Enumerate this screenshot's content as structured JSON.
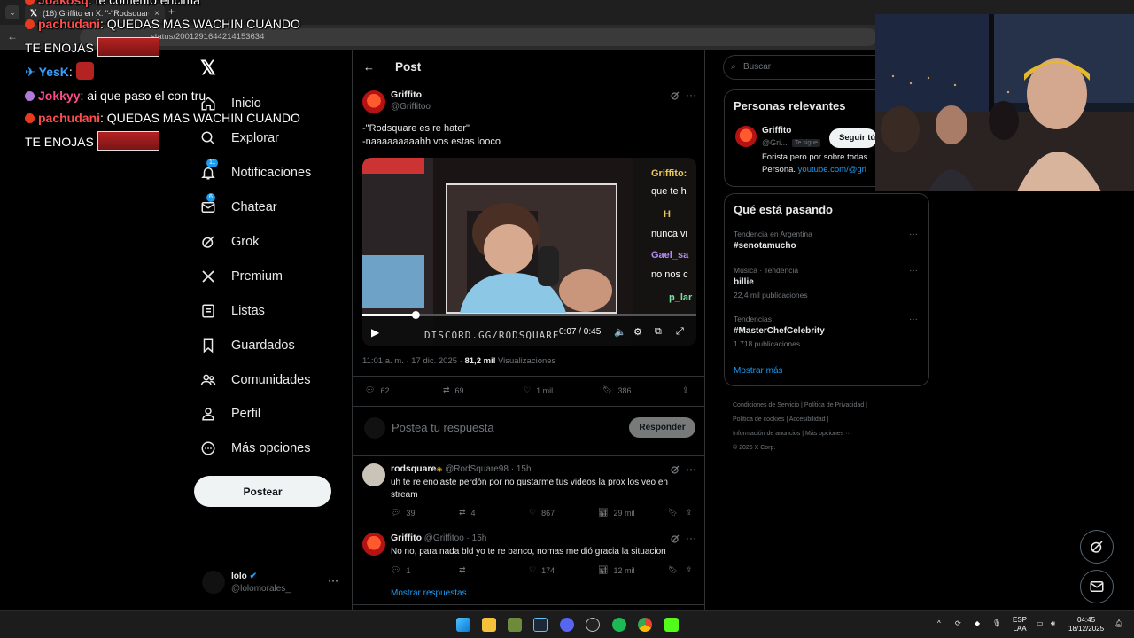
{
  "browser": {
    "tab_title": "(16) Griffito en X: \"-\"Rodsquare",
    "url_fragment": "status/2001291644214153634",
    "new_tab": "+",
    "close": "×"
  },
  "chat_overlay": [
    {
      "user": "Joakosq",
      "message": ": te comento encima"
    },
    {
      "user": "pachudani",
      "message": ": QUEDAS MAS WACHIN CUANDO"
    },
    {
      "continuation": "TE ENOJAS"
    },
    {
      "user": "YesK",
      "message": ":"
    },
    {
      "user": "Jokkyy",
      "message": ": ai que paso el con tru"
    },
    {
      "user": "pachudani",
      "message": ": QUEDAS MAS WACHIN CUANDO"
    },
    {
      "continuation": "TE ENOJAS"
    }
  ],
  "sidebar": {
    "items": [
      {
        "label": "Inicio",
        "icon": "home-icon"
      },
      {
        "label": "Explorar",
        "icon": "search-icon"
      },
      {
        "label": "Notificaciones",
        "icon": "bell-icon",
        "badge": "11"
      },
      {
        "label": "Chatear",
        "icon": "mail-icon",
        "badge": "6"
      },
      {
        "label": "Grok",
        "icon": "grok-icon"
      },
      {
        "label": "Premium",
        "icon": "x-icon"
      },
      {
        "label": "Listas",
        "icon": "list-icon"
      },
      {
        "label": "Guardados",
        "icon": "bookmark-icon"
      },
      {
        "label": "Comunidades",
        "icon": "people-icon"
      },
      {
        "label": "Perfil",
        "icon": "person-icon"
      },
      {
        "label": "Más opciones",
        "icon": "more-circle-icon"
      }
    ],
    "post_button": "Postear",
    "account": {
      "name": "lolo",
      "handle": "@lolomorales_",
      "more": "···"
    }
  },
  "post": {
    "header_title": "Post",
    "author_name": "Griffito",
    "author_handle": "@Griffitoo",
    "text": "-\"Rodsquare es re hater\"\n-naaaaaaaaahh vos estas looco",
    "video": {
      "time": "0:07 / 0:45",
      "overlay_text": "DISCORD.GG/RODSQUARE",
      "side_chat": [
        "Griffito:",
        "que te h",
        "H",
        "nunca vi",
        "Gael_sa",
        "no nos c",
        "p_lar",
        "H",
        "nunca vi"
      ],
      "progress": 0.16
    },
    "meta_time": "11:01 a. m. · 17 dic. 2025 ·",
    "meta_views": "81,2 mil",
    "meta_views_label": "Visualizaciones",
    "actions": {
      "replies": "62",
      "reposts": "69",
      "likes": "1 mil",
      "bookmarks": "386"
    },
    "reply_placeholder": "Postea tu respuesta",
    "reply_button": "Responder"
  },
  "replies": [
    {
      "name": "rodsquare",
      "handle": "@RodSquare98 · 15h",
      "text": "uh te re enojaste perdón por no gustarme tus videos la prox los veo en stream",
      "replies": "39",
      "reposts": "4",
      "likes": "867",
      "views": "29 mil"
    },
    {
      "name": "Griffito",
      "handle": "@Griffitoo · 15h",
      "text": "No no, para nada bld yo te re banco, nomas me dió gracia la situacion",
      "replies": "1",
      "reposts": "",
      "likes": "174",
      "views": "12 mil"
    }
  ],
  "show_replies": "Mostrar respuestas",
  "right": {
    "search_placeholder": "Buscar",
    "relevant_title": "Personas relevantes",
    "relevant": {
      "name": "Griffito",
      "handle": "@Gri...",
      "follows_you": "Te sigue",
      "follow_button": "Seguir tú",
      "bio": "Forista pero por sobre todas",
      "bio2": "Persona.",
      "link": "youtube.com/@gri"
    },
    "trends_title": "Qué está pasando",
    "trends": [
      {
        "meta": "Tendencia en Argentina",
        "name": "#senotamucho",
        "count": ""
      },
      {
        "meta": "Música · Tendencia",
        "name": "billie",
        "count": "22,4 mil publicaciones"
      },
      {
        "meta": "Tendencias",
        "name": "#MasterChefCelebrity",
        "count": "1.718 publicaciones"
      }
    ],
    "show_more": "Mostrar más",
    "footer": [
      "Condiciones de Servicio",
      "Política de Privacidad",
      "Política de cookies",
      "Accesibilidad",
      "Información de anuncios",
      "Más opciones ···",
      "© 2025 X Corp."
    ]
  },
  "taskbar": {
    "lang": "ESP",
    "layout": "LAA",
    "time": "04:45",
    "date": "18/12/2025"
  },
  "colors": {
    "accent": "#1d9bf0",
    "background": "#000000",
    "border": "#2f3336",
    "muted": "#71767b"
  }
}
